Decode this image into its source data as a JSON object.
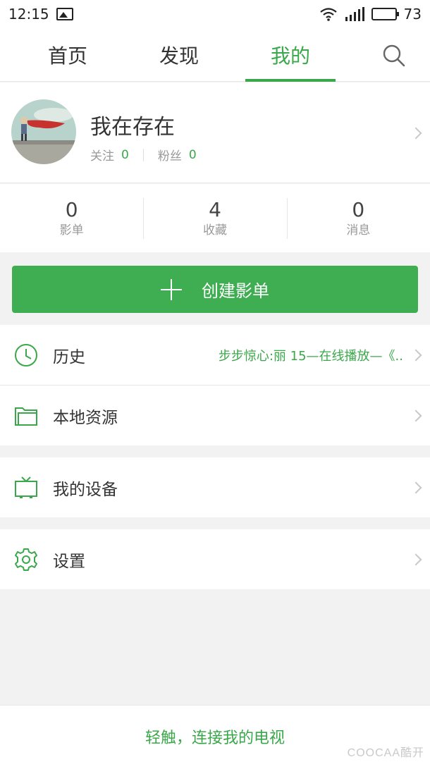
{
  "status_bar": {
    "time": "12:15",
    "battery": "73"
  },
  "nav": {
    "tabs": [
      {
        "label": "首页"
      },
      {
        "label": "发现"
      },
      {
        "label": "我的"
      }
    ],
    "active_tab": "我的",
    "search_icon": "search-icon"
  },
  "profile": {
    "username": "我在存在",
    "follow_label": "关注",
    "follow_count": "0",
    "fans_label": "粉丝",
    "fans_count": "0"
  },
  "stats": [
    {
      "value": "0",
      "label": "影单"
    },
    {
      "value": "4",
      "label": "收藏"
    },
    {
      "value": "0",
      "label": "消息"
    }
  ],
  "create_button": {
    "label": "创建影单"
  },
  "menu": {
    "history": {
      "label": "历史",
      "detail": "步步惊心:丽 15—在线播放—《.."
    },
    "local": {
      "label": "本地资源"
    },
    "devices": {
      "label": "我的设备"
    },
    "settings": {
      "label": "设置"
    }
  },
  "bottom_bar": {
    "label": "轻触，连接我的电视",
    "watermark": "COOCAA酷开"
  },
  "colors": {
    "accent": "#3aa84a",
    "button": "#3fae52",
    "background": "#f2f2f2"
  }
}
